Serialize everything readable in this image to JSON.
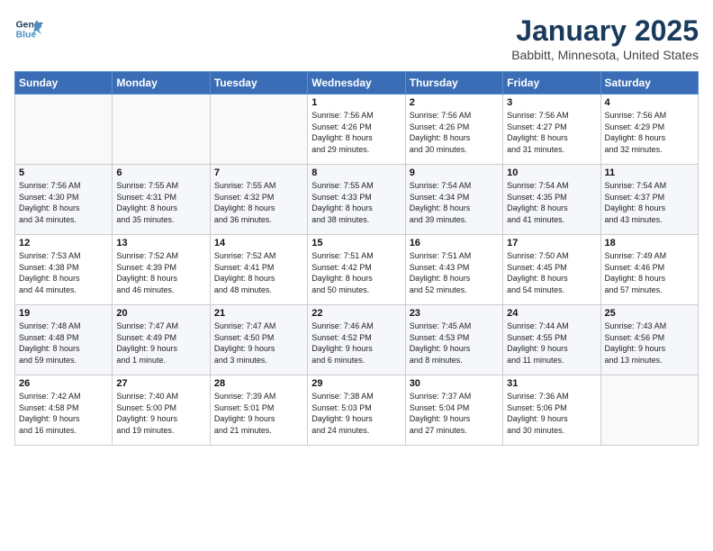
{
  "logo": {
    "line1": "General",
    "line2": "Blue"
  },
  "title": "January 2025",
  "subtitle": "Babbitt, Minnesota, United States",
  "days_of_week": [
    "Sunday",
    "Monday",
    "Tuesday",
    "Wednesday",
    "Thursday",
    "Friday",
    "Saturday"
  ],
  "weeks": [
    [
      {
        "day": "",
        "info": ""
      },
      {
        "day": "",
        "info": ""
      },
      {
        "day": "",
        "info": ""
      },
      {
        "day": "1",
        "info": "Sunrise: 7:56 AM\nSunset: 4:26 PM\nDaylight: 8 hours\nand 29 minutes."
      },
      {
        "day": "2",
        "info": "Sunrise: 7:56 AM\nSunset: 4:26 PM\nDaylight: 8 hours\nand 30 minutes."
      },
      {
        "day": "3",
        "info": "Sunrise: 7:56 AM\nSunset: 4:27 PM\nDaylight: 8 hours\nand 31 minutes."
      },
      {
        "day": "4",
        "info": "Sunrise: 7:56 AM\nSunset: 4:29 PM\nDaylight: 8 hours\nand 32 minutes."
      }
    ],
    [
      {
        "day": "5",
        "info": "Sunrise: 7:56 AM\nSunset: 4:30 PM\nDaylight: 8 hours\nand 34 minutes."
      },
      {
        "day": "6",
        "info": "Sunrise: 7:55 AM\nSunset: 4:31 PM\nDaylight: 8 hours\nand 35 minutes."
      },
      {
        "day": "7",
        "info": "Sunrise: 7:55 AM\nSunset: 4:32 PM\nDaylight: 8 hours\nand 36 minutes."
      },
      {
        "day": "8",
        "info": "Sunrise: 7:55 AM\nSunset: 4:33 PM\nDaylight: 8 hours\nand 38 minutes."
      },
      {
        "day": "9",
        "info": "Sunrise: 7:54 AM\nSunset: 4:34 PM\nDaylight: 8 hours\nand 39 minutes."
      },
      {
        "day": "10",
        "info": "Sunrise: 7:54 AM\nSunset: 4:35 PM\nDaylight: 8 hours\nand 41 minutes."
      },
      {
        "day": "11",
        "info": "Sunrise: 7:54 AM\nSunset: 4:37 PM\nDaylight: 8 hours\nand 43 minutes."
      }
    ],
    [
      {
        "day": "12",
        "info": "Sunrise: 7:53 AM\nSunset: 4:38 PM\nDaylight: 8 hours\nand 44 minutes."
      },
      {
        "day": "13",
        "info": "Sunrise: 7:52 AM\nSunset: 4:39 PM\nDaylight: 8 hours\nand 46 minutes."
      },
      {
        "day": "14",
        "info": "Sunrise: 7:52 AM\nSunset: 4:41 PM\nDaylight: 8 hours\nand 48 minutes."
      },
      {
        "day": "15",
        "info": "Sunrise: 7:51 AM\nSunset: 4:42 PM\nDaylight: 8 hours\nand 50 minutes."
      },
      {
        "day": "16",
        "info": "Sunrise: 7:51 AM\nSunset: 4:43 PM\nDaylight: 8 hours\nand 52 minutes."
      },
      {
        "day": "17",
        "info": "Sunrise: 7:50 AM\nSunset: 4:45 PM\nDaylight: 8 hours\nand 54 minutes."
      },
      {
        "day": "18",
        "info": "Sunrise: 7:49 AM\nSunset: 4:46 PM\nDaylight: 8 hours\nand 57 minutes."
      }
    ],
    [
      {
        "day": "19",
        "info": "Sunrise: 7:48 AM\nSunset: 4:48 PM\nDaylight: 8 hours\nand 59 minutes."
      },
      {
        "day": "20",
        "info": "Sunrise: 7:47 AM\nSunset: 4:49 PM\nDaylight: 9 hours\nand 1 minute."
      },
      {
        "day": "21",
        "info": "Sunrise: 7:47 AM\nSunset: 4:50 PM\nDaylight: 9 hours\nand 3 minutes."
      },
      {
        "day": "22",
        "info": "Sunrise: 7:46 AM\nSunset: 4:52 PM\nDaylight: 9 hours\nand 6 minutes."
      },
      {
        "day": "23",
        "info": "Sunrise: 7:45 AM\nSunset: 4:53 PM\nDaylight: 9 hours\nand 8 minutes."
      },
      {
        "day": "24",
        "info": "Sunrise: 7:44 AM\nSunset: 4:55 PM\nDaylight: 9 hours\nand 11 minutes."
      },
      {
        "day": "25",
        "info": "Sunrise: 7:43 AM\nSunset: 4:56 PM\nDaylight: 9 hours\nand 13 minutes."
      }
    ],
    [
      {
        "day": "26",
        "info": "Sunrise: 7:42 AM\nSunset: 4:58 PM\nDaylight: 9 hours\nand 16 minutes."
      },
      {
        "day": "27",
        "info": "Sunrise: 7:40 AM\nSunset: 5:00 PM\nDaylight: 9 hours\nand 19 minutes."
      },
      {
        "day": "28",
        "info": "Sunrise: 7:39 AM\nSunset: 5:01 PM\nDaylight: 9 hours\nand 21 minutes."
      },
      {
        "day": "29",
        "info": "Sunrise: 7:38 AM\nSunset: 5:03 PM\nDaylight: 9 hours\nand 24 minutes."
      },
      {
        "day": "30",
        "info": "Sunrise: 7:37 AM\nSunset: 5:04 PM\nDaylight: 9 hours\nand 27 minutes."
      },
      {
        "day": "31",
        "info": "Sunrise: 7:36 AM\nSunset: 5:06 PM\nDaylight: 9 hours\nand 30 minutes."
      },
      {
        "day": "",
        "info": ""
      }
    ]
  ]
}
